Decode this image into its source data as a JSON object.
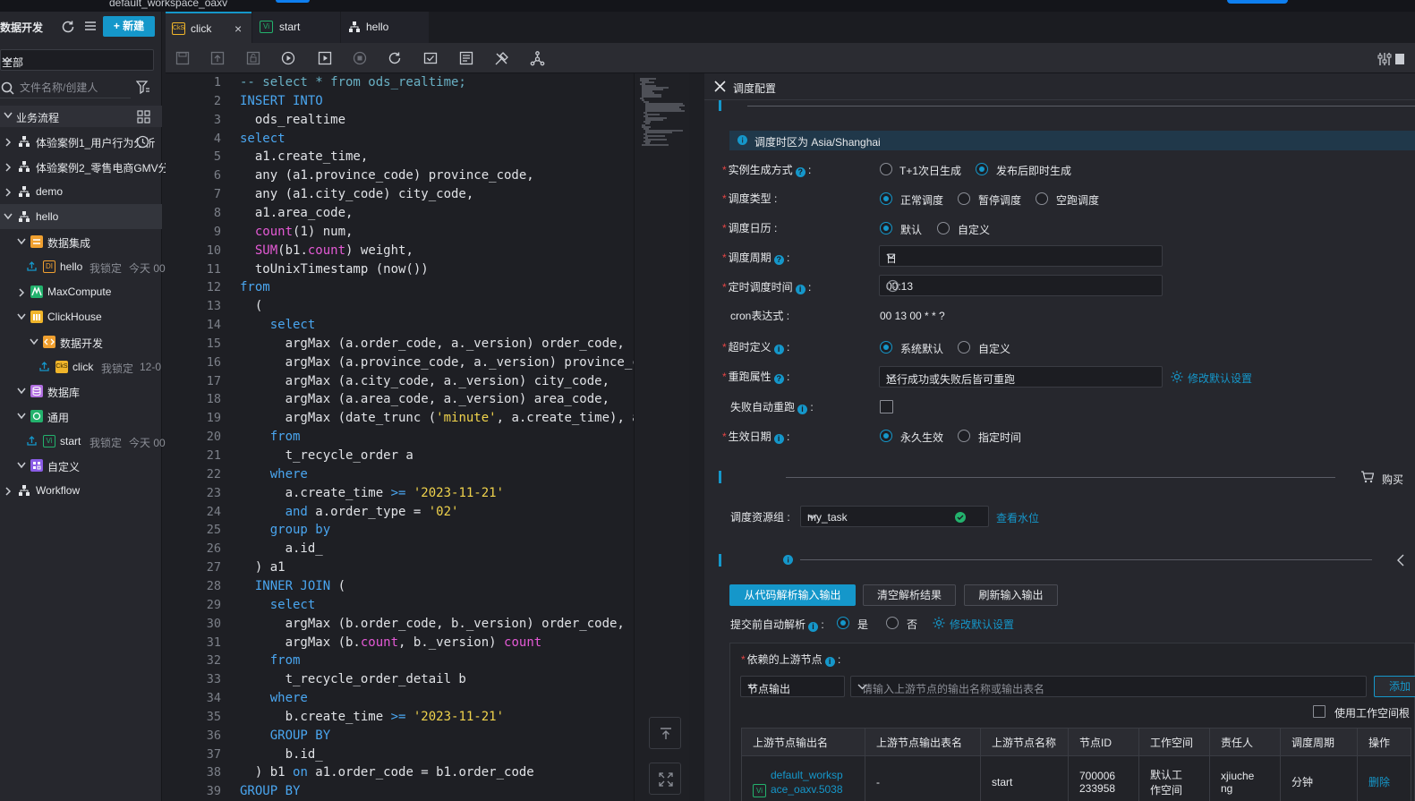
{
  "topbar": {
    "workspace": "default_workspace_oaxv"
  },
  "sidebar": {
    "title": "数据开发",
    "new_button": "+ 新建",
    "filter_value": "全部",
    "search_placeholder": "文件名称/创建人",
    "section": "业务流程",
    "tree": [
      {
        "label": "体验案例1_用户行为分析"
      },
      {
        "label": "体验案例2_零售电商GMV分"
      },
      {
        "label": "demo"
      },
      {
        "label": "hello"
      },
      {
        "label": "数据集成"
      },
      {
        "label": "hello",
        "locked": "我锁定",
        "time": "今天 00"
      },
      {
        "label": "MaxCompute"
      },
      {
        "label": "ClickHouse"
      },
      {
        "label": "数据开发"
      },
      {
        "label": "click",
        "locked": "我锁定",
        "time": "12-0"
      },
      {
        "label": "数据库"
      },
      {
        "label": "通用"
      },
      {
        "label": "start",
        "locked": "我锁定",
        "time": "今天 00"
      },
      {
        "label": "自定义"
      },
      {
        "label": "Workflow"
      }
    ]
  },
  "tabs": [
    {
      "label": "click",
      "icon": "CkS"
    },
    {
      "label": "start",
      "icon": "Vi"
    },
    {
      "label": "hello",
      "icon": ""
    }
  ],
  "editor": {
    "lines": [
      {
        "n": "1",
        "html": "<span class=\"cm\">-- select * from ods_realtime;</span>"
      },
      {
        "n": "2",
        "html": "<span class=\"kw\">INSERT INTO</span>"
      },
      {
        "n": "3",
        "html": "  ods_realtime"
      },
      {
        "n": "4",
        "html": "<span class=\"kw\">select</span>"
      },
      {
        "n": "5",
        "html": "  a1.create_time,"
      },
      {
        "n": "6",
        "html": "  any (a1.province_code) province_code,"
      },
      {
        "n": "7",
        "html": "  any (a1.city_code) city_code,"
      },
      {
        "n": "8",
        "html": "  a1.area_code,"
      },
      {
        "n": "9",
        "html": "  <span class=\"fn\">count</span>(1) num,"
      },
      {
        "n": "10",
        "html": "  <span class=\"fn\">SUM</span>(b1.<span class=\"fn\">count</span>) weight,"
      },
      {
        "n": "11",
        "html": "  toUnixTimestamp (now())"
      },
      {
        "n": "12",
        "html": "<span class=\"kw\">from</span>"
      },
      {
        "n": "13",
        "html": "  ("
      },
      {
        "n": "14",
        "html": "    <span class=\"kw\">select</span>"
      },
      {
        "n": "15",
        "html": "      argMax (a.order_code, a._version) order_code,"
      },
      {
        "n": "16",
        "html": "      argMax (a.province_code, a._version) province_c"
      },
      {
        "n": "17",
        "html": "      argMax (a.city_code, a._version) city_code,"
      },
      {
        "n": "18",
        "html": "      argMax (a.area_code, a._version) area_code,"
      },
      {
        "n": "19",
        "html": "      argMax (date_trunc (<span class=\"str\">'minute'</span>, a.create_time), a"
      },
      {
        "n": "20",
        "html": "    <span class=\"kw\">from</span>"
      },
      {
        "n": "21",
        "html": "      t_recycle_order a"
      },
      {
        "n": "22",
        "html": "    <span class=\"kw\">where</span>"
      },
      {
        "n": "23",
        "html": "      a.create_time <span class=\"kw\">&gt;=</span> <span class=\"str\">'2023-11-21'</span>"
      },
      {
        "n": "24",
        "html": "      <span class=\"kw\">and</span> a.order_type = <span class=\"str\">'02'</span>"
      },
      {
        "n": "25",
        "html": "    <span class=\"kw\">group by</span>"
      },
      {
        "n": "26",
        "html": "      a.id_"
      },
      {
        "n": "27",
        "html": "  ) a1"
      },
      {
        "n": "28",
        "html": "  <span class=\"kw\">INNER JOIN</span> ("
      },
      {
        "n": "29",
        "html": "    <span class=\"kw\">select</span>"
      },
      {
        "n": "30",
        "html": "      argMax (b.order_code, b._version) order_code,"
      },
      {
        "n": "31",
        "html": "      argMax (b.<span class=\"fn\">count</span>, b._version) <span class=\"fn\">count</span>"
      },
      {
        "n": "32",
        "html": "    <span class=\"kw\">from</span>"
      },
      {
        "n": "33",
        "html": "      t_recycle_order_detail b"
      },
      {
        "n": "34",
        "html": "    <span class=\"kw\">where</span>"
      },
      {
        "n": "35",
        "html": "      b.create_time <span class=\"kw\">&gt;=</span> <span class=\"str\">'2023-11-21'</span>"
      },
      {
        "n": "36",
        "html": "    <span class=\"kw\">GROUP BY</span>"
      },
      {
        "n": "37",
        "html": "      b.id_"
      },
      {
        "n": "38",
        "html": "  ) b1 <span class=\"kw\">on</span> a1.order_code = b1.order_code"
      },
      {
        "n": "39",
        "html": "<span class=\"kw\">GROUP BY</span>"
      }
    ]
  },
  "panel": {
    "title": "调度配置",
    "timezone_notice": "调度时区为 Asia/Shanghai",
    "fields": {
      "instance_mode": {
        "label": "实例生成方式",
        "options": [
          "T+1次日生成",
          "发布后即时生成"
        ],
        "selected": 1
      },
      "schedule_type": {
        "label": "调度类型",
        "options": [
          "正常调度",
          "暂停调度",
          "空跑调度"
        ],
        "selected": 0
      },
      "calendar": {
        "label": "调度日历",
        "options": [
          "默认",
          "自定义"
        ],
        "selected": 0
      },
      "period": {
        "label": "调度周期",
        "value": "日"
      },
      "time": {
        "label": "定时调度时间",
        "value": "00:13"
      },
      "cron": {
        "label": "cron表达式",
        "value": "00 13 00 * * ?"
      },
      "timeout": {
        "label": "超时定义",
        "options": [
          "系统默认",
          "自定义"
        ],
        "selected": 0
      },
      "rerun": {
        "label": "重跑属性",
        "value": "运行成功或失败后皆可重跑",
        "link": "修改默认设置"
      },
      "auto_rerun": {
        "label": "失败自动重跑"
      },
      "effective": {
        "label": "生效日期",
        "options": [
          "永久生效",
          "指定时间"
        ],
        "selected": 0
      }
    },
    "buy_link": "购买",
    "resource_group": {
      "label": "调度资源组",
      "value": "my_task",
      "link": "查看水位"
    },
    "buttons": {
      "parse": "从代码解析输入输出",
      "clear": "清空解析结果",
      "refresh": "刷新输入输出"
    },
    "auto_parse": {
      "label": "提交前自动解析",
      "options": [
        "是",
        "否"
      ],
      "selected": 0,
      "link": "修改默认设置"
    },
    "deps": {
      "label": "依赖的上游节点",
      "select": "节点输出",
      "placeholder": "请输入上游节点的输出名称或输出表名",
      "add": "添加",
      "use_workspace": "使用工作空间根",
      "columns": [
        "上游节点输出名",
        "上游节点输出表名",
        "上游节点名称",
        "节点ID",
        "工作空间",
        "责任人",
        "调度周期",
        "操作"
      ],
      "row": {
        "output_name_1": "default_worksp",
        "output_name_2": "ace_oaxv.5038",
        "output_table": "-",
        "node_name": "start",
        "node_id_1": "700006",
        "node_id_2": "233958",
        "workspace_1": "默认工",
        "workspace_2": "作空间",
        "owner_1": "xjiuche",
        "owner_2": "ng",
        "period": "分钟",
        "action": "删除"
      }
    }
  }
}
